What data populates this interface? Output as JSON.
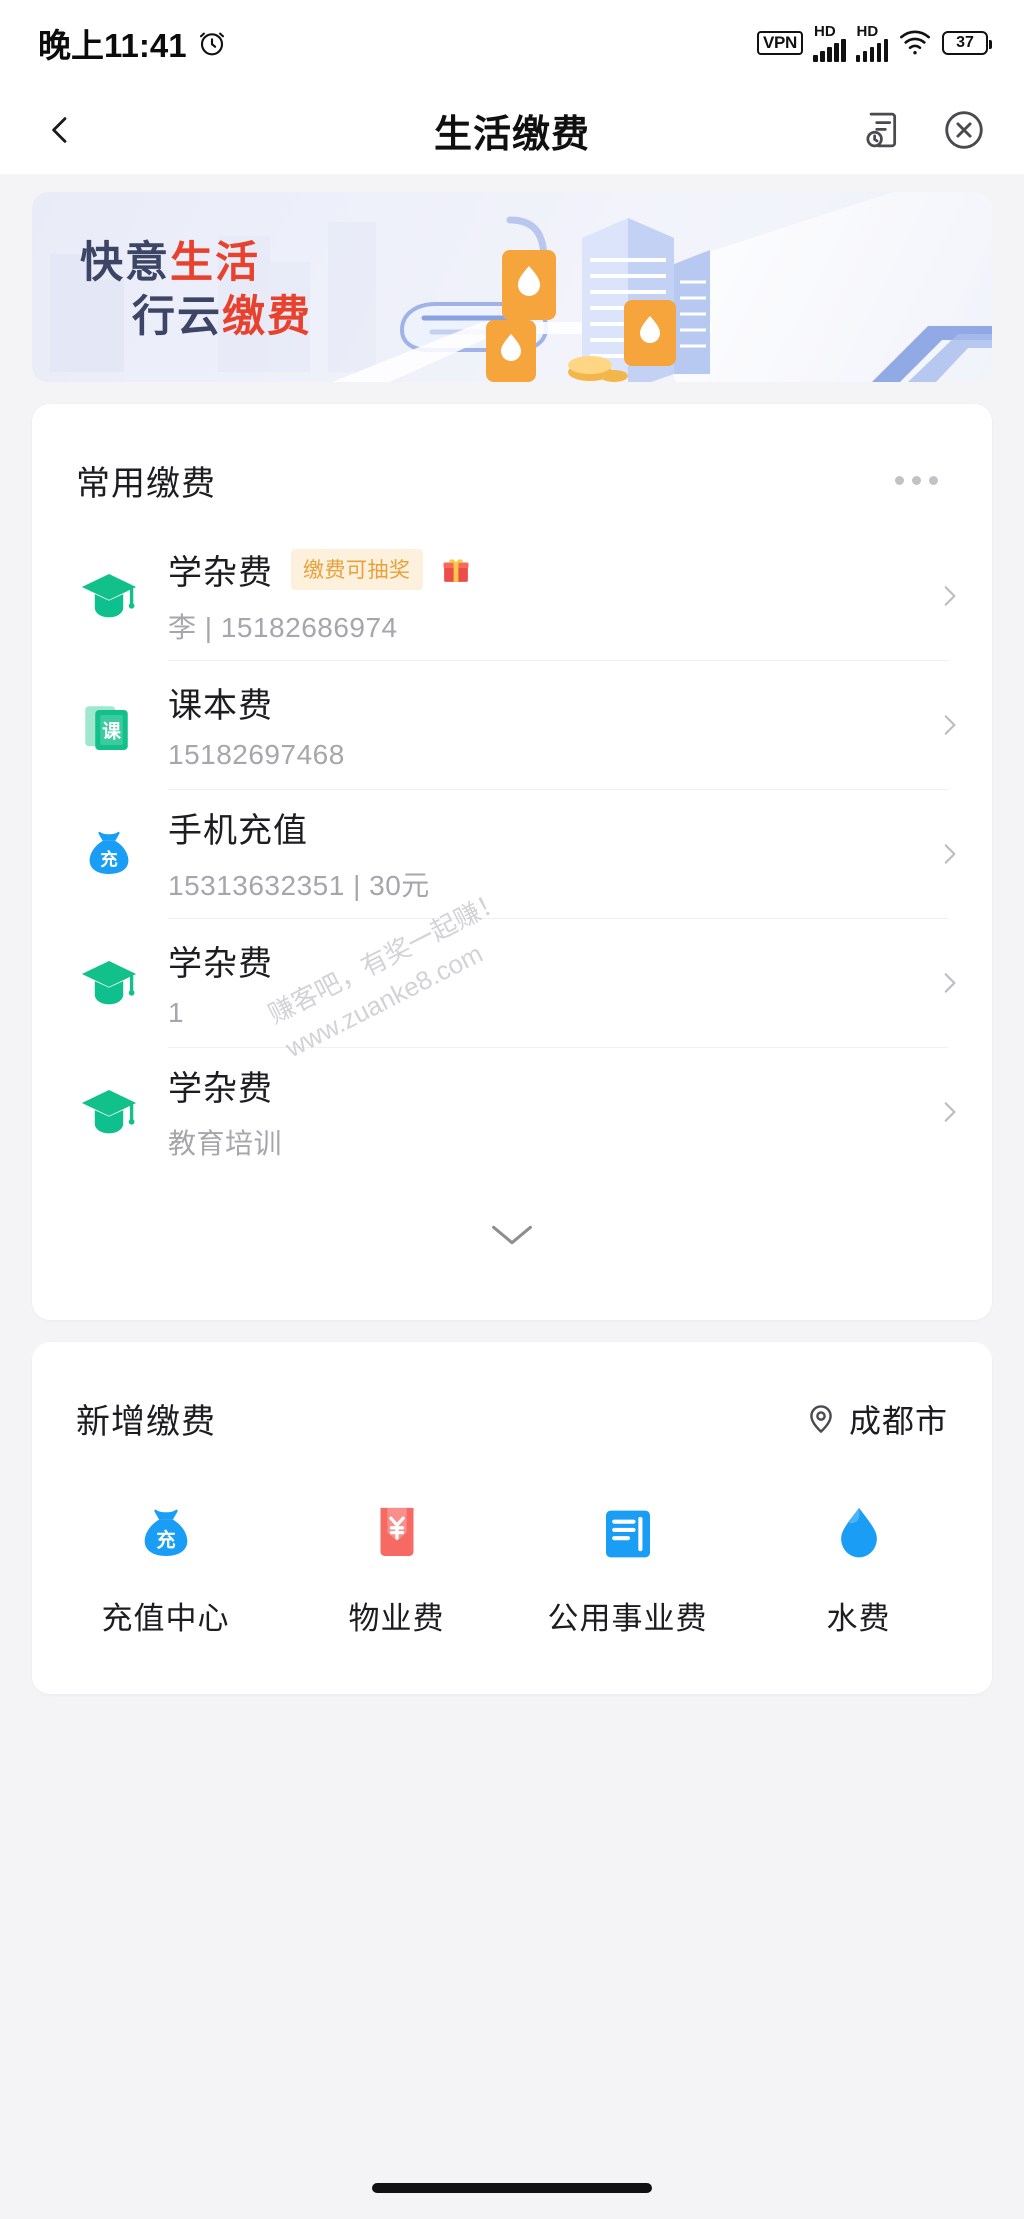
{
  "status_bar": {
    "time": "晚上11:41",
    "alarm_icon": "alarm-clock-icon",
    "vpn_label": "VPN",
    "hd_label_1": "HD",
    "hd_label_2": "HD",
    "wifi_icon": "wifi-icon",
    "battery_level": "37"
  },
  "nav": {
    "back_icon": "back-chevron-icon",
    "title": "生活缴费",
    "record_icon": "bill-record-icon",
    "close_icon": "close-circle-icon"
  },
  "banner": {
    "line1_dark": "快意",
    "line1_red": "生活",
    "line2_dark": "行云",
    "line2_red": "缴费",
    "dark_color": "#3d4566",
    "red_color": "#e8412e",
    "bg_color": "#e9ebf8"
  },
  "frequent": {
    "title": "常用缴费",
    "more_icon": "more-dots-icon",
    "expand_icon": "chevron-down-icon",
    "items": [
      {
        "icon": "graduation-cap-icon",
        "icon_color": "#12c08a",
        "title": "学杂费",
        "badge": "缴费可抽奖",
        "badge_color": "#e8a23c",
        "badge_bg": "#fdf0dc",
        "gift_icon": "gift-icon",
        "subtitle": "李 | 15182686974",
        "chevron": "chevron-right-icon"
      },
      {
        "icon": "textbook-icon",
        "icon_color": "#12c08a",
        "icon_glyph": "课",
        "title": "课本费",
        "badge": "",
        "subtitle": "15182697468",
        "chevron": "chevron-right-icon"
      },
      {
        "icon": "money-bag-icon",
        "icon_color": "#1a9ef5",
        "icon_glyph": "充",
        "title": "手机充值",
        "badge": "",
        "subtitle": "15313632351 | 30元",
        "chevron": "chevron-right-icon"
      },
      {
        "icon": "graduation-cap-icon",
        "icon_color": "#12c08a",
        "title": "学杂费",
        "badge": "",
        "subtitle": "1",
        "chevron": "chevron-right-icon"
      },
      {
        "icon": "graduation-cap-icon",
        "icon_color": "#12c08a",
        "title": "学杂费",
        "badge": "",
        "subtitle": "教育培训",
        "chevron": "chevron-right-icon"
      }
    ]
  },
  "add_payment": {
    "title": "新增缴费",
    "location_icon": "location-pin-icon",
    "location": "成都市",
    "services": [
      {
        "icon": "money-bag-icon",
        "icon_glyph": "充",
        "color": "#1a9ef5",
        "label": "充值中心"
      },
      {
        "icon": "property-fee-icon",
        "color": "#f76a63",
        "label": "物业费"
      },
      {
        "icon": "utility-bill-icon",
        "color": "#1a9ef5",
        "label": "公用事业费"
      },
      {
        "icon": "water-drop-icon",
        "color": "#1a9ef5",
        "label": "水费"
      }
    ]
  },
  "watermark": {
    "line1": "赚客吧，有奖一起赚！",
    "line2": "www.zuanke8.com"
  }
}
